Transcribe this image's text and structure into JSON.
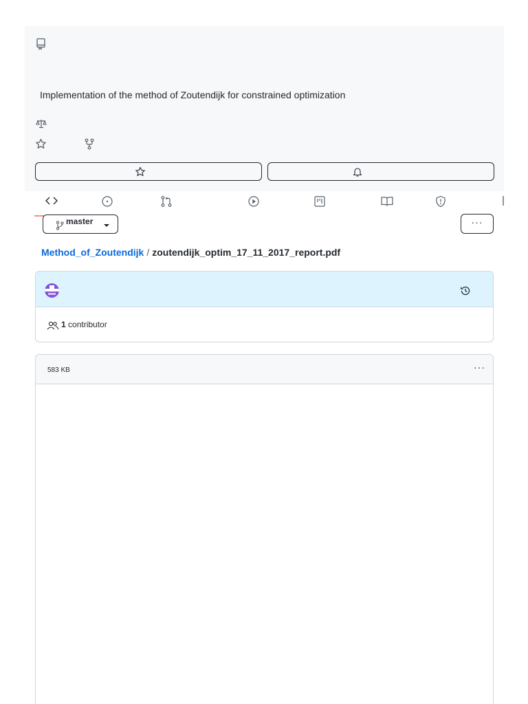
{
  "repo": {
    "description": "Implementation of the method of Zoutendijk for constrained optimization"
  },
  "tabs": [
    {
      "icon": "code-icon"
    },
    {
      "icon": "issues-icon"
    },
    {
      "icon": "pull-requests-icon"
    },
    {
      "icon": "actions-icon"
    },
    {
      "icon": "projects-icon"
    },
    {
      "icon": "wiki-icon"
    },
    {
      "icon": "security-icon"
    }
  ],
  "branch": {
    "label": "master"
  },
  "more_label": "···",
  "breadcrumb": {
    "repo": "Method_of_Zoutendijk",
    "separator": "/",
    "file": "zoutendijk_optim_17_11_2017_report.pdf"
  },
  "commit": {
    "contributor_count": "1",
    "contributor_label": "contributor"
  },
  "file": {
    "size": "583 KB",
    "more_label": "···"
  },
  "colors": {
    "accent": "#0969da",
    "tab_underline": "#fd8c73",
    "commit_bg": "#ddf4ff",
    "avatar": "#8250df"
  }
}
